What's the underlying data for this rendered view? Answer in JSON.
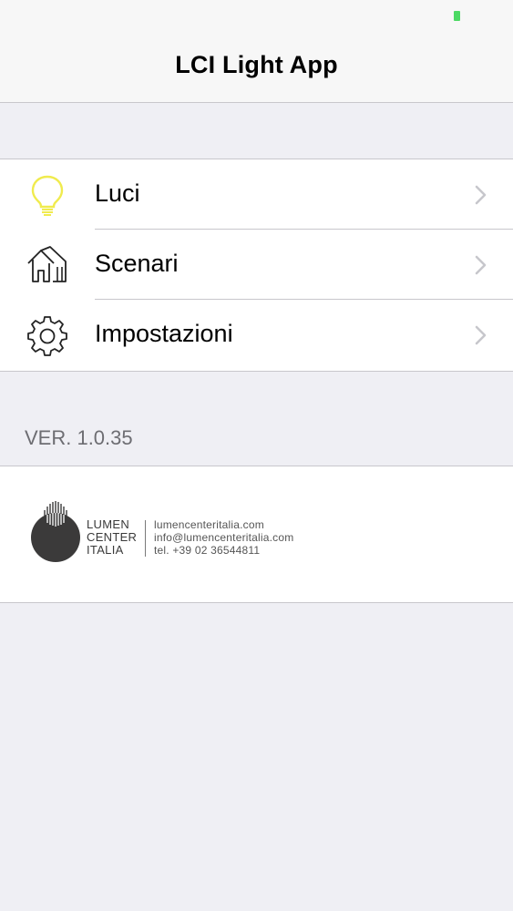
{
  "nav": {
    "title": "LCI Light App"
  },
  "menu": {
    "items": [
      {
        "label": "Luci",
        "icon": "lightbulb-icon"
      },
      {
        "label": "Scenari",
        "icon": "house-icon"
      },
      {
        "label": "Impostazioni",
        "icon": "gear-icon"
      }
    ]
  },
  "version": "VER. 1.0.35",
  "footer": {
    "logo_lines": [
      "LUMEN",
      "CENTER",
      "ITALIA"
    ],
    "website": "lumencenteritalia.com",
    "email": "info@lumencenteritalia.com",
    "phone": "tel. +39 02 36544811"
  },
  "colors": {
    "background": "#efeff4",
    "separator": "#c8c7cc",
    "bulb": "#f3ef5a",
    "battery": "#4cd964",
    "chevron": "#c7c7cc"
  }
}
